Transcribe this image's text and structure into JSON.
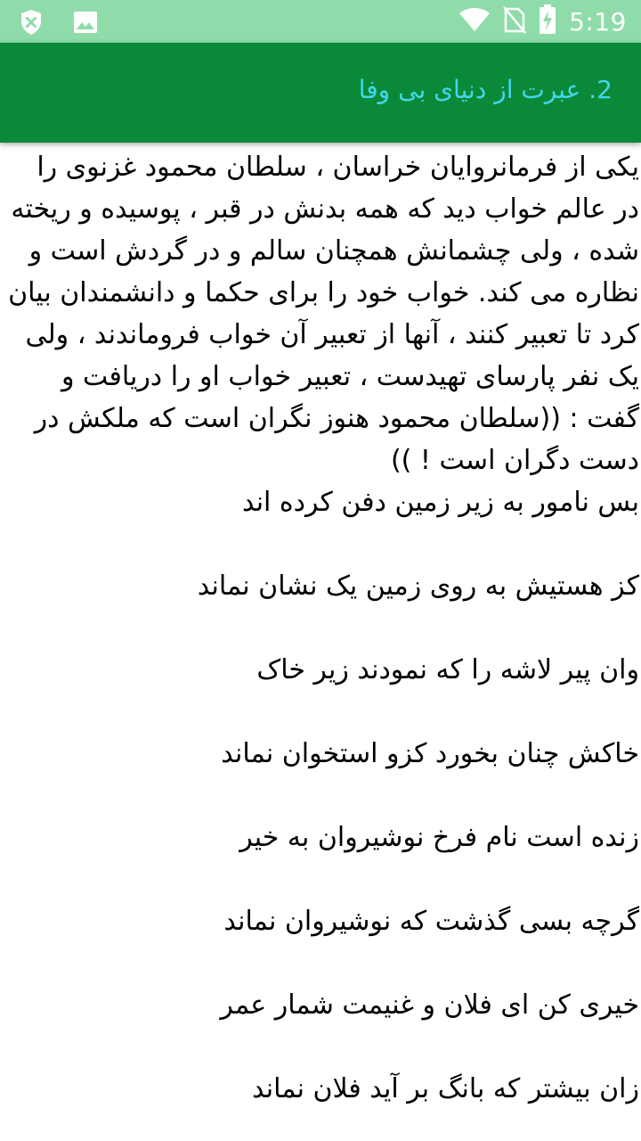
{
  "status_bar": {
    "time": "5:19",
    "icons": [
      "shield-icon",
      "image-icon",
      "wifi-icon",
      "no-sim-icon",
      "battery-charging-icon"
    ],
    "background": "#8fdcaa"
  },
  "app_bar": {
    "title": "2. عبرت از دنیای بی وفا",
    "background": "#0a8a38",
    "title_color": "#44d6ee"
  },
  "content": {
    "story": "یکی از فرمانروایان خراسان ، سلطان محمود غزنوی را در عالم خواب دید که همه بدنش در قبر ، پوسیده و ریخته شده ، ولی چشمانش همچنان سالم و در گردش است و نظاره می کند. خواب خود را برای حکما و دانشمندان بیان کرد تا تعبیر کنند ، آنها از تعبیر آن خواب فروماندند ، ولی یک نفر پارسای تهیدست ، تعبیر خواب او را دریافت و گفت : ((سلطان محمود هنوز نگران است که ملکش در دست دگران است ! ))",
    "verses": [
      "بس نامور به زیر زمین دفن کرده اند",
      "کز هستیش به روی زمین یک نشان نماند",
      "وان پیر لاشه را که نمودند زیر خاک",
      "خاکش چنان بخورد کزو استخوان نماند",
      "زنده است نام فرخ نوشیروان به خیر",
      "گرچه بسی گذشت که نوشیروان نماند",
      "خیری کن ای فلان و غنیمت شمار عمر",
      "زان بیشتر که بانگ بر آید فلان نماند"
    ]
  }
}
